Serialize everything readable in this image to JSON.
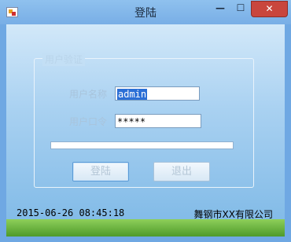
{
  "window": {
    "title": "登陆",
    "min_glyph": "—",
    "max_glyph": "☐",
    "close_glyph": "✕"
  },
  "group": {
    "legend": "用户验证",
    "username_label": "用户名称",
    "password_label": "用户口令",
    "username_value": "admin",
    "password_value": "*****",
    "progress_percent": 0
  },
  "buttons": {
    "login": "登陆",
    "exit": "退出"
  },
  "status": {
    "datetime": "2015-06-26 08:45:18",
    "company": "舞钢市XX有限公司"
  },
  "colors": {
    "titlebar": "#78aee6",
    "close_button": "#c9463d"
  },
  "icons": [
    "app-icon",
    "minimize-icon",
    "maximize-icon",
    "close-icon"
  ]
}
